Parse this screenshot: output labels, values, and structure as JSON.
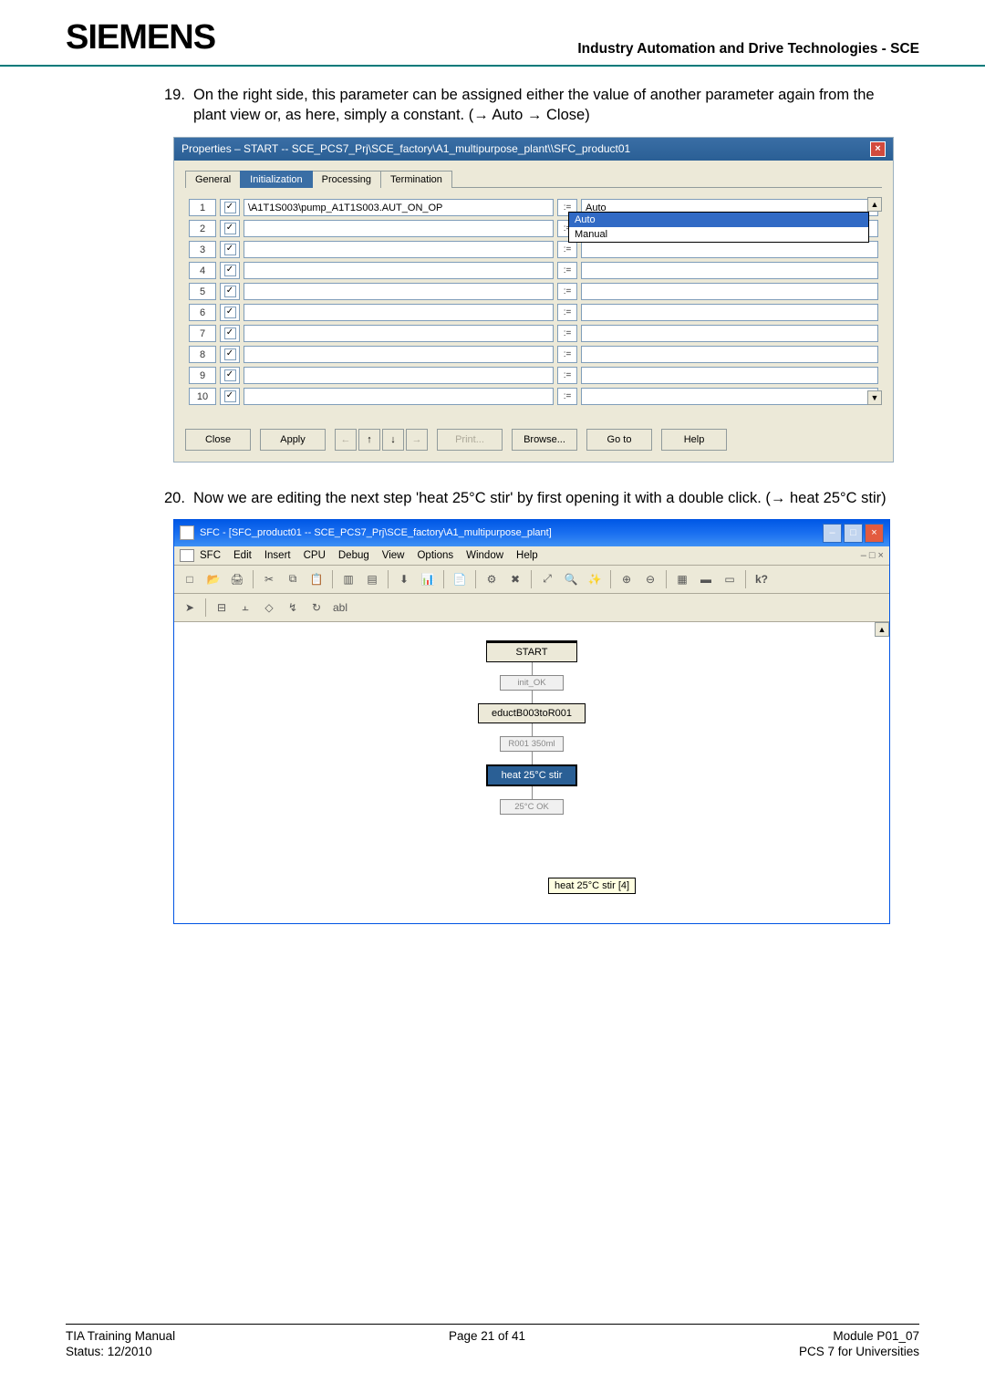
{
  "header": {
    "logo": "SIEMENS",
    "desc": "Industry Automation and Drive Technologies - SCE"
  },
  "step1": {
    "num": "19.",
    "text": "On the right side, this parameter can be assigned either the value of another parameter again from the plant view or, as here, simply a constant. (→ Auto → Close)"
  },
  "dialog": {
    "title": "Properties – START -- SCE_PCS7_Prj\\SCE_factory\\A1_multipurpose_plant\\\\SFC_product01",
    "tabs": [
      "General",
      "Initialization",
      "Processing",
      "Termination"
    ],
    "row1_name": "\\A1T1S003\\pump_A1T1S003.AUT_ON_OP",
    "row1_value": "Auto",
    "assign_symbol": ":=",
    "dropdown": {
      "opt1": "Auto",
      "opt2": "Manual"
    },
    "buttons": {
      "close": "Close",
      "apply": "Apply",
      "print": "Print...",
      "browse": "Browse...",
      "goto": "Go to",
      "help": "Help"
    },
    "arrows": {
      "left": "←",
      "up": "↑",
      "down": "↓",
      "right": "→"
    }
  },
  "step2": {
    "num": "20.",
    "text": "Now we are editing the next step 'heat 25°C stir' by first opening it with a double click. (→ heat 25°C stir)"
  },
  "sfc": {
    "title": "SFC - [SFC_product01 -- SCE_PCS7_Prj\\SCE_factory\\A1_multipurpose_plant]",
    "menus": [
      "SFC",
      "Edit",
      "Insert",
      "CPU",
      "Debug",
      "View",
      "Options",
      "Window",
      "Help"
    ],
    "mdi_controls": "–  □  ×",
    "steps": {
      "start": "START",
      "trans1": "init_OK",
      "step2": "eductB003toR001",
      "trans2": "R001 350ml",
      "step3": "heat 25°C stir",
      "trans3": "25°C OK",
      "tooltip": "heat 25°C stir [4]"
    }
  },
  "footer": {
    "left1": "TIA Training Manual",
    "left2": "Status: 12/2010",
    "center": "Page 21 of 41",
    "right1": "Module P01_07",
    "right2": "PCS 7 for Universities"
  }
}
